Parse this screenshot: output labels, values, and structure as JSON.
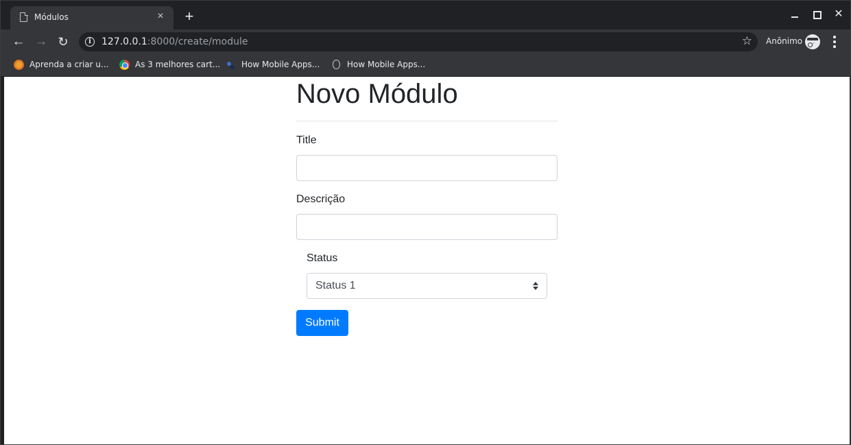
{
  "browser": {
    "tab_title": "Módulos",
    "tab_close": "×",
    "new_tab": "+",
    "window_close": "✕",
    "nav_back": "←",
    "nav_forward": "→",
    "nav_reload": "↻",
    "url_host": "127.0.0.1",
    "url_rest": ":8000/create/module",
    "info_glyph": "i",
    "star_glyph": "☆",
    "profile_label": "Anônimo",
    "bookmarks": [
      {
        "label": "Aprenda a criar u...",
        "icon": "orange-site-favicon"
      },
      {
        "label": "As 3 melhores cart...",
        "icon": "chrome-favicon"
      },
      {
        "label": "How Mobile Apps...",
        "icon": "dark-site-favicon"
      },
      {
        "label": "How Mobile Apps...",
        "icon": "page-icon"
      }
    ]
  },
  "page": {
    "heading": "Novo Módulo",
    "labels": {
      "title": "Title",
      "description": "Descrição",
      "status": "Status"
    },
    "fields": {
      "title_value": "",
      "description_value": ""
    },
    "status_select": {
      "selected": "Status 1"
    },
    "submit_label": "Submit"
  },
  "colors": {
    "primary": "#007bff",
    "chrome_dark": "#35363a"
  }
}
